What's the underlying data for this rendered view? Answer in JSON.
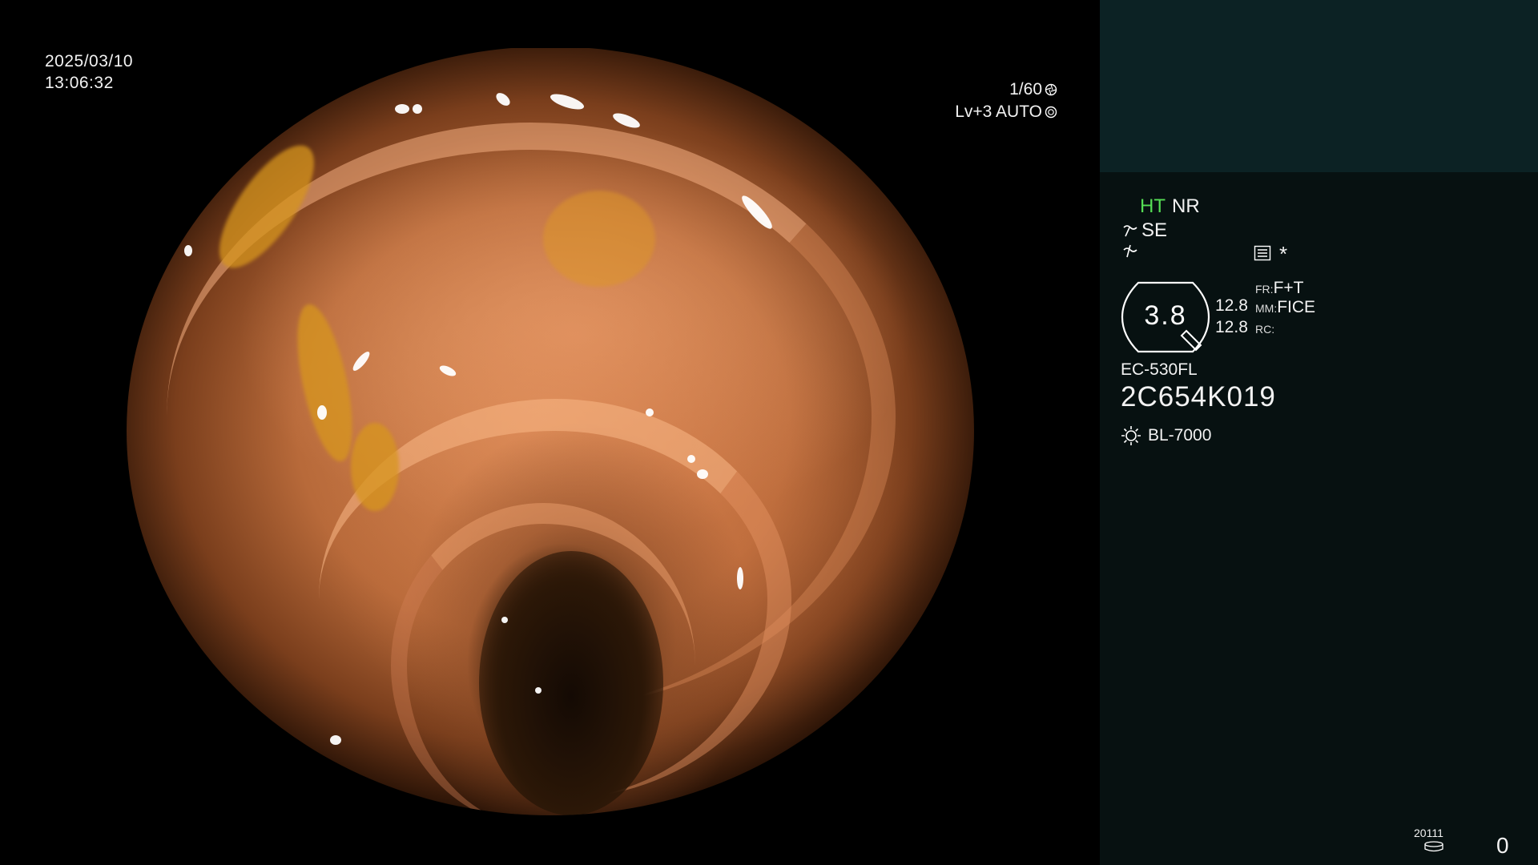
{
  "overlay": {
    "date": "2025/03/10",
    "time": "13:06:32",
    "shutter": "1/60",
    "exposure": "Lv+3 AUTO"
  },
  "panel": {
    "ht": "HT",
    "nr": "NR",
    "se": "SE",
    "star": "*",
    "zoom": "3.8",
    "value_a": "12.8",
    "value_b": "12.8",
    "fr_key": "FR:",
    "fr_value": "F+T",
    "mm_key": "MM:",
    "mm_value": "FICE",
    "rc_key": "RC:",
    "rc_value": "",
    "scope_model": "EC-530FL",
    "serial": "2C654K019",
    "light_source": "BL-7000",
    "storage_label": "20111",
    "counter": "0"
  },
  "icons": {
    "shutter": "aperture-icon",
    "exposure": "exposure-ring-icon",
    "se": "tilde-arrow-icon",
    "enhance": "enhance-icon",
    "menu": "menu-list-icon",
    "light": "sun-icon",
    "storage": "disk-icon"
  },
  "colors": {
    "panel_bg": "#071111",
    "panel_top_bg": "#0c2224",
    "ht": "#55dd55"
  }
}
